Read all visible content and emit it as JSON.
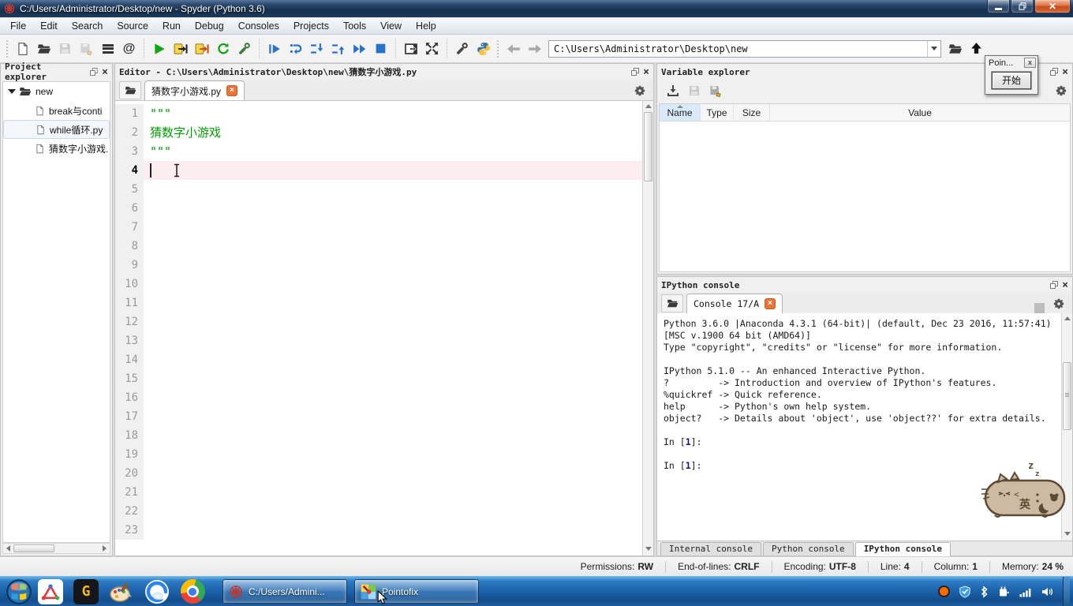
{
  "window": {
    "title": "C:/Users/Administrator/Desktop/new - Spyder (Python 3.6)"
  },
  "menu_items": [
    "File",
    "Edit",
    "Search",
    "Source",
    "Run",
    "Debug",
    "Consoles",
    "Projects",
    "Tools",
    "View",
    "Help"
  ],
  "toolbar": {
    "path_value": "C:\\Users\\Administrator\\Desktop\\new"
  },
  "project_explorer": {
    "title": "Project explorer",
    "root_folder": "new",
    "files": [
      "break与conti",
      "while循环.py",
      "猜数字小游戏."
    ]
  },
  "editor": {
    "title": "Editor - C:\\Users\\Administrator\\Desktop\\new\\猜数字小游戏.py",
    "tab_label": "猜数字小游戏.py",
    "lines": [
      {
        "num": "1",
        "code": "\"\"\"",
        "string": true
      },
      {
        "num": "2",
        "code": "猜数字小游戏",
        "string": true
      },
      {
        "num": "3",
        "code": "\"\"\"",
        "string": true
      },
      {
        "num": "4",
        "code": "",
        "current": true
      },
      {
        "num": "5",
        "code": ""
      },
      {
        "num": "6",
        "code": ""
      },
      {
        "num": "7",
        "code": ""
      },
      {
        "num": "8",
        "code": ""
      },
      {
        "num": "9",
        "code": ""
      },
      {
        "num": "10",
        "code": ""
      },
      {
        "num": "11",
        "code": ""
      },
      {
        "num": "12",
        "code": ""
      },
      {
        "num": "13",
        "code": ""
      },
      {
        "num": "14",
        "code": ""
      },
      {
        "num": "15",
        "code": ""
      },
      {
        "num": "16",
        "code": ""
      },
      {
        "num": "17",
        "code": ""
      },
      {
        "num": "18",
        "code": ""
      },
      {
        "num": "19",
        "code": ""
      },
      {
        "num": "20",
        "code": ""
      },
      {
        "num": "21",
        "code": ""
      },
      {
        "num": "22",
        "code": ""
      },
      {
        "num": "23",
        "code": ""
      }
    ]
  },
  "variable_explorer": {
    "title": "Variable explorer",
    "columns": [
      "Name",
      "Type",
      "Size",
      "Value"
    ]
  },
  "ipython_console": {
    "title": "IPython console",
    "tab_label": "Console 17/A",
    "lines": [
      {
        "type": "text",
        "text": "Python 3.6.0 |Anaconda 4.3.1 (64-bit)| (default, Dec 23 2016, 11:57:41)"
      },
      {
        "type": "text",
        "text": "[MSC v.1900 64 bit (AMD64)]"
      },
      {
        "type": "text",
        "text": "Type \"copyright\", \"credits\" or \"license\" for more information."
      },
      {
        "type": "blank"
      },
      {
        "type": "text",
        "text": "IPython 5.1.0 -- An enhanced Interactive Python."
      },
      {
        "type": "text",
        "text": "?         -> Introduction and overview of IPython's features."
      },
      {
        "type": "text",
        "text": "%quickref -> Quick reference."
      },
      {
        "type": "text",
        "text": "help      -> Python's own help system."
      },
      {
        "type": "text",
        "text": "object?   -> Details about 'object', use 'object??' for extra details."
      },
      {
        "type": "blank"
      },
      {
        "type": "prompt",
        "prefix": "In [",
        "num": "1",
        "suffix": "]:"
      },
      {
        "type": "blank"
      },
      {
        "type": "prompt",
        "prefix": "In [",
        "num": "1",
        "suffix": "]:"
      }
    ],
    "bottom_tabs": [
      "Internal console",
      "Python console",
      "IPython console"
    ],
    "active_bottom_tab": "IPython console"
  },
  "pointofix": {
    "title": "Poin...",
    "start_button": "开始"
  },
  "statusbar": {
    "permissions_label": "Permissions:",
    "permissions": "RW",
    "eol_label": "End-of-lines:",
    "eol": "CRLF",
    "encoding_label": "Encoding:",
    "encoding": "UTF-8",
    "line_label": "Line:",
    "line": "4",
    "column_label": "Column:",
    "column": "1",
    "memory_label": "Memory:",
    "memory": "24 %"
  },
  "taskbar": {
    "buttons": [
      {
        "label": "C:/Users/Admini..."
      },
      {
        "label": "Pointofix"
      }
    ]
  },
  "cat_sticker": {
    "zzz": "z",
    "zzz2": "z",
    "body_text": "英"
  },
  "colors": {
    "close_button": "#d9542b",
    "tab_close": "#e8743a",
    "run_green": "#17a317",
    "debug_blue": "#2a72c8",
    "docstring_green": "#00a000",
    "taskbar_blue": "#1d64ad"
  }
}
